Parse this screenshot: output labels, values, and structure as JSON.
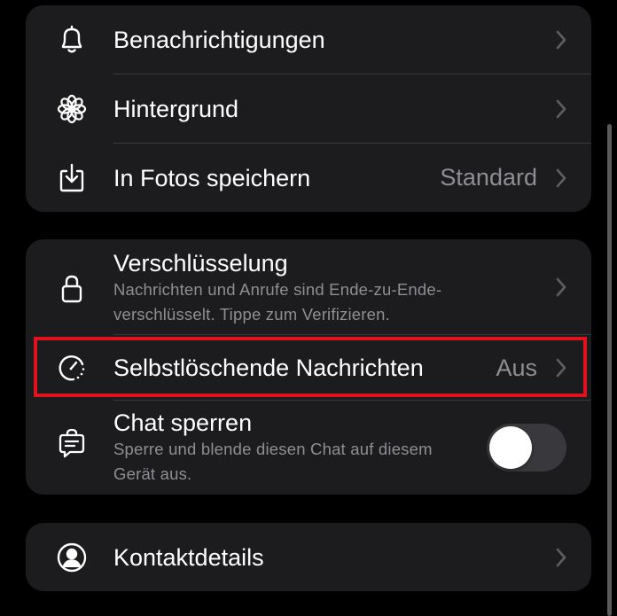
{
  "colors": {
    "background": "#000000",
    "group_background": "#1c1c1e",
    "primary_text": "#ffffff",
    "secondary_text": "#8e8e93",
    "divider": "#38383a",
    "highlight_border": "#e1111d",
    "toggle_off": "#39393d"
  },
  "group1": {
    "items": [
      {
        "icon": "bell-icon",
        "label": "Benachrichtigungen",
        "value": ""
      },
      {
        "icon": "flower-icon",
        "label": "Hintergrund",
        "value": ""
      },
      {
        "icon": "save-download-icon",
        "label": "In Fotos speichern",
        "value": "Standard"
      }
    ]
  },
  "group2": {
    "encryption": {
      "icon": "lock-icon",
      "label": "Verschlüsselung",
      "sublabel": "Nachrichten und Anrufe sind Ende-zu-Ende-verschlüsselt. Tippe zum Verifizieren."
    },
    "disappearing": {
      "icon": "timer-icon",
      "label": "Selbstlöschende Nachrichten",
      "value": "Aus",
      "highlighted": true
    },
    "chat_lock": {
      "icon": "chat-lock-icon",
      "label": "Chat sperren",
      "sublabel": "Sperre und blende diesen Chat auf diesem Gerät aus.",
      "toggle_on": false
    }
  },
  "group3": {
    "contact": {
      "icon": "contact-icon",
      "label": "Kontaktdetails"
    }
  }
}
